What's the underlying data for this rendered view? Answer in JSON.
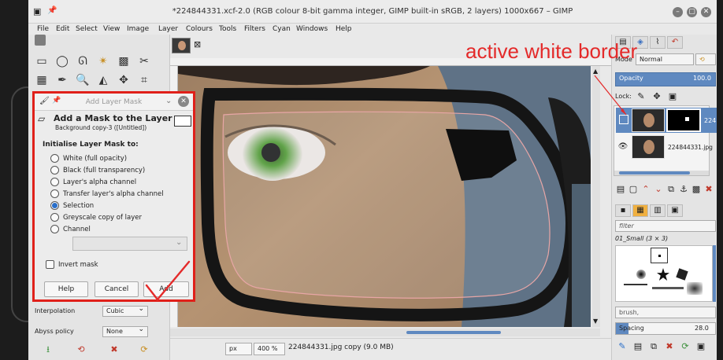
{
  "window": {
    "title": "*224844331.xcf-2.0 (RGB colour 8-bit gamma integer, GIMP built-in sRGB, 2 layers) 1000x667 – GIMP",
    "close_glyph": "✕",
    "minimize_glyph": "–",
    "maximize_glyph": "▢"
  },
  "menubar": [
    "File",
    "Edit",
    "Select",
    "View",
    "Image",
    "Layer",
    "Colours",
    "Tools",
    "Filters",
    "Cyan",
    "Windows",
    "Help"
  ],
  "tool_options": {
    "interpolation_label": "Interpolation",
    "interpolation_value": "Cubic",
    "abyss_label": "Abyss policy",
    "abyss_value": "None"
  },
  "dialog": {
    "title": "Add Layer Mask",
    "heading": "Add a Mask to the Layer",
    "layer_name": "Background copy-3 ([Untitled])",
    "section_label": "Initialise Layer Mask to:",
    "options": [
      "White (full opacity)",
      "Black (full transparency)",
      "Layer's alpha channel",
      "Transfer layer's alpha channel",
      "Selection",
      "Greyscale copy of layer",
      "Channel"
    ],
    "selected_index": 4,
    "invert_label": "Invert mask",
    "invert_checked": false,
    "help_label": "Help",
    "cancel_label": "Cancel",
    "add_label": "Add"
  },
  "status": {
    "unit": "px",
    "zoom": "400 %",
    "message": "224844331.jpg copy (9.0 MB)"
  },
  "layers_panel": {
    "mode_label": "Mode",
    "mode_value": "Normal",
    "opacity_label": "Opacity",
    "opacity_value": "100.0",
    "lock_label": "Lock:",
    "layer_top_name": "224",
    "layer_bottom_name": "224844331.jpg"
  },
  "brushes_panel": {
    "filter_placeholder": "filter",
    "brush_name": "01_Small (3 × 3)",
    "tag_placeholder": "brush,",
    "spacing_label": "Spacing",
    "spacing_value": "28.0"
  },
  "annotation": {
    "text": "active white border",
    "color": "#e42a2a"
  },
  "colors": {
    "highlight_red": "#e0201a",
    "accent_blue": "#5f89c0",
    "radio_blue": "#2a6fc9"
  }
}
